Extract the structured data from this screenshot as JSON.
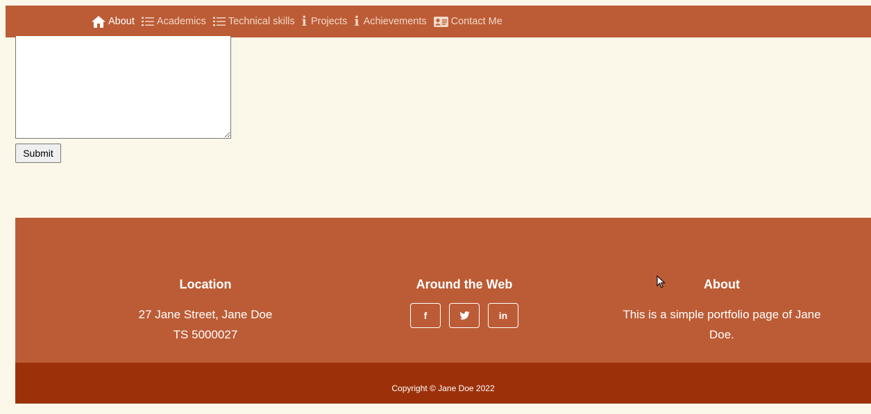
{
  "nav": {
    "items": [
      {
        "label": "About",
        "icon": "home-icon",
        "active": true
      },
      {
        "label": "Academics",
        "icon": "list-icon"
      },
      {
        "label": "Technical skills",
        "icon": "list-icon"
      },
      {
        "label": "Projects",
        "icon": "info-icon"
      },
      {
        "label": "Achievements",
        "icon": "info-icon"
      },
      {
        "label": "Contact Me",
        "icon": "id-card-icon"
      }
    ]
  },
  "form": {
    "message_value": "",
    "submit_label": "Submit"
  },
  "footer": {
    "location": {
      "heading": "Location",
      "line1": "27 Jane Street, Jane Doe",
      "line2": "TS 5000027"
    },
    "web": {
      "heading": "Around the Web",
      "links": [
        {
          "label": "f",
          "icon": "facebook-icon"
        },
        {
          "label": "twitter",
          "icon": "twitter-icon"
        },
        {
          "label": "in",
          "icon": "linkedin-icon"
        }
      ]
    },
    "about": {
      "heading": "About",
      "text": "This is a simple portfolio page of Jane Doe."
    }
  },
  "copyright": "Copyright © Jane Doe 2022",
  "colors": {
    "navbar": "#bc5c36",
    "page_background": "#fbf8ea",
    "footer": "#bc5c36",
    "copyright_bar": "#9c3109"
  }
}
